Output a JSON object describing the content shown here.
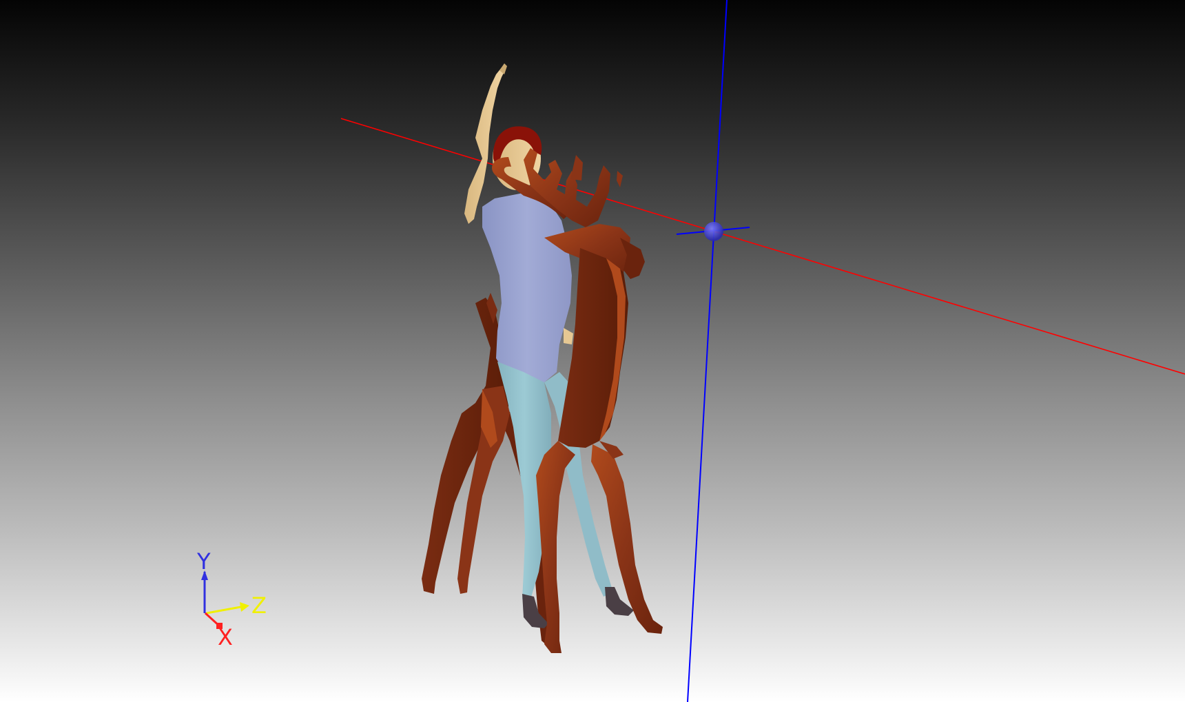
{
  "viewport": {
    "background_top": "#040404",
    "background_bottom": "#ffffff"
  },
  "scene": {
    "objects": [
      {
        "name": "reindeer",
        "material": "wood",
        "color": "#8a3417"
      },
      {
        "name": "human-figure",
        "shirt_color": "#9aa3cf",
        "pants_color": "#94c1cc",
        "skin_color": "#e6c893",
        "hair_color": "#8a1208",
        "shoe_color": "#4a3f45"
      }
    ],
    "manipulator": {
      "line_x_color": "#ff0000",
      "line_y_color": "#0000ff",
      "handle_icon": "pivot-sphere-icon"
    }
  },
  "axis_triad": {
    "x_label": "X",
    "y_label": "Y",
    "z_label": "Z",
    "x_color": "#ff2020",
    "y_color": "#3030e0",
    "z_color": "#f0f000"
  }
}
